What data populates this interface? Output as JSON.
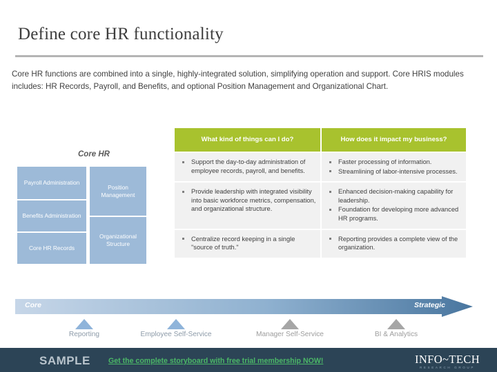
{
  "slide": {
    "title": "Define core HR functionality",
    "intro": "Core HR functions are combined into a single, highly-integrated solution, simplifying operation and support. Core HRIS modules includes: HR Records, Payroll, and Benefits, and optional Position Management and Organizational Chart."
  },
  "diagram": {
    "heading": "Core HR",
    "boxes": [
      {
        "label": "Payroll Administration"
      },
      {
        "label": "Benefits Administration"
      },
      {
        "label": "Core HR Records"
      },
      {
        "label": "Position Management"
      },
      {
        "label": "Organizational Structure"
      }
    ],
    "box_color": "#9dbad8"
  },
  "table": {
    "headers": [
      "What kind of things can I do?",
      "How does it impact my business?"
    ],
    "header_color": "#a8c22e",
    "rows": [
      {
        "left": [
          "Support the day-to-day administration of employee records, payroll, and benefits."
        ],
        "right": [
          "Faster processing of information.",
          "Streamlining of labor-intensive processes."
        ]
      },
      {
        "left": [
          "Provide leadership with integrated visibility into basic workforce metrics, compensation, and organizational structure."
        ],
        "right": [
          "Enhanced decision-making capability for leadership.",
          "Foundation for developing more advanced HR programs."
        ]
      },
      {
        "left": [
          "Centralize record keeping in a single \"source of truth.\""
        ],
        "right": [
          "Reporting provides a complete view of the organization."
        ]
      }
    ]
  },
  "continuum": {
    "start_label": "Core",
    "end_label": "Strategic",
    "gradient_start": "#c6d6e8",
    "gradient_end": "#4a7aa7",
    "markers": [
      {
        "label": "Reporting",
        "color": "#8fb4da"
      },
      {
        "label": "Employee Self-Service",
        "color": "#8fb4da"
      },
      {
        "label": "Manager Self-Service",
        "color": "#a6a6a6"
      },
      {
        "label": "BI & Analytics",
        "color": "#a6a6a6"
      }
    ]
  },
  "footer": {
    "sample_label": "SAMPLE",
    "cta_text": "Get the complete storyboard with free trial membership NOW!",
    "cta_color": "#4bb767",
    "logo_main": "INFO~TECH",
    "logo_sub": "RESEARCH GROUP",
    "background": "#2c4456"
  }
}
